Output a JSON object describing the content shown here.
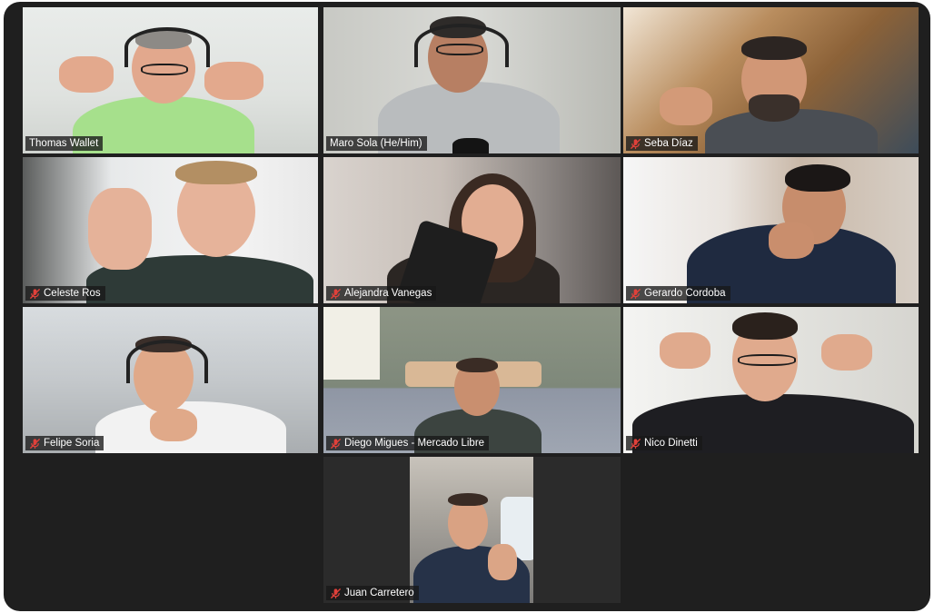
{
  "meeting": {
    "participants": [
      {
        "name": "Thomas Wallet",
        "muted": false,
        "speaking": false
      },
      {
        "name": "Maro Sola (He/Him)",
        "muted": false,
        "speaking": true
      },
      {
        "name": "Seba Díaz",
        "muted": true,
        "speaking": false
      },
      {
        "name": "Celeste Ros",
        "muted": true,
        "speaking": false
      },
      {
        "name": "Alejandra Vanegas",
        "muted": true,
        "speaking": false
      },
      {
        "name": "Gerardo Cordoba",
        "muted": true,
        "speaking": false
      },
      {
        "name": "Felipe Soria",
        "muted": true,
        "speaking": false
      },
      {
        "name": "Diego Migues - Mercado Libre",
        "muted": true,
        "speaking": false
      },
      {
        "name": "Nico Dinetti",
        "muted": true,
        "speaking": false
      },
      {
        "name": "Juan Carretero",
        "muted": true,
        "speaking": false
      }
    ]
  },
  "colors": {
    "background": "#1f1f1f",
    "active_speaker_border": "#c7e354",
    "mute_icon": "#e0403a",
    "name_tag_bg": "#181818"
  },
  "icons": {
    "mute": "microphone-off-icon"
  }
}
